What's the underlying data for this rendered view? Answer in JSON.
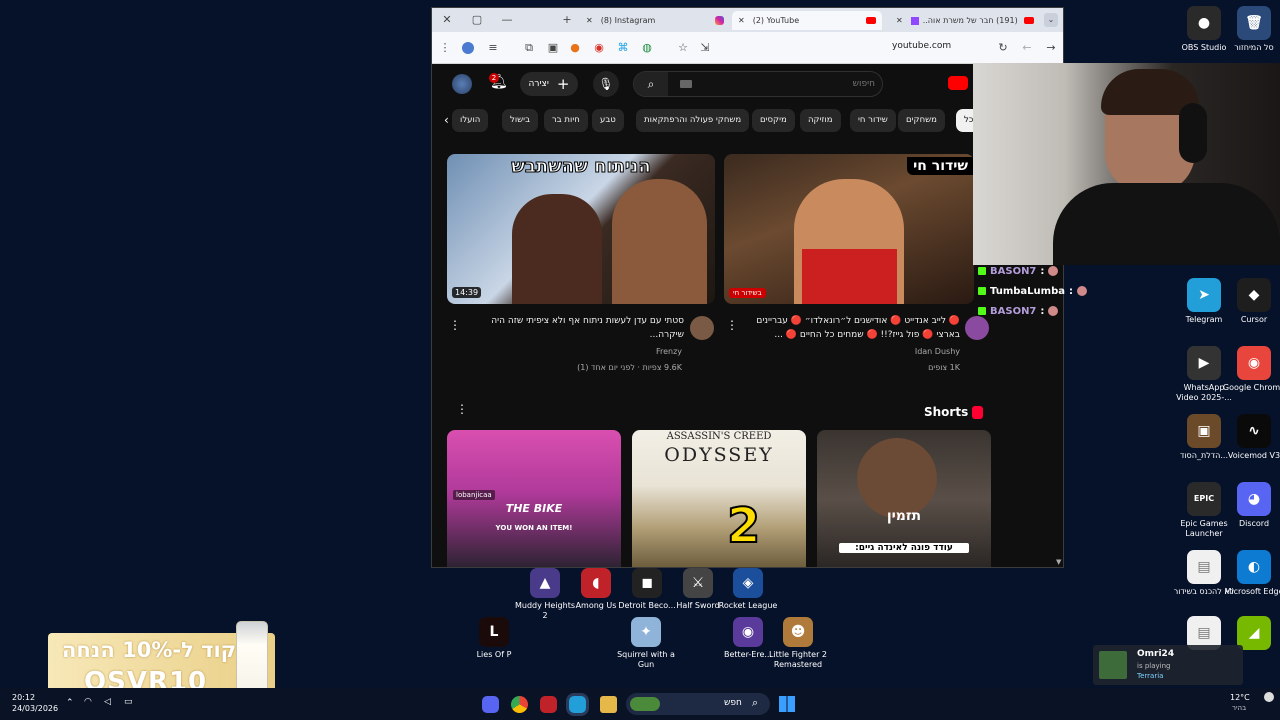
{
  "desktop": {
    "icons_right": [
      {
        "label": "OBS Studio",
        "glyph": "●",
        "color": "#2a2a2a"
      },
      {
        "label": "סל המיחזור",
        "glyph": "🗑",
        "color": "#2b4a7a"
      },
      {
        "label": "Telegram",
        "glyph": "➤",
        "color": "#229ed9"
      },
      {
        "label": "Cursor",
        "glyph": "◆",
        "color": "#1e1e1e"
      },
      {
        "label": "WhatsApp Video 2025-...",
        "glyph": "▶",
        "color": "#333"
      },
      {
        "label": "Google Chrome",
        "glyph": "◉",
        "color": "#e8453c"
      },
      {
        "label": "הדלת_הסוד...",
        "glyph": "▣",
        "color": "#6b4a2a"
      },
      {
        "label": "Voicemod V3",
        "glyph": "∿",
        "color": "#0a0a0a"
      },
      {
        "label": "Epic Games Launcher",
        "glyph": "EPIC",
        "color": "#2a2a2a"
      },
      {
        "label": "Discord",
        "glyph": "◕",
        "color": "#5865f2"
      },
      {
        "label": "לא להכנס בשידור",
        "glyph": "▤",
        "color": "#f0f0f0"
      },
      {
        "label": "Microsoft Edge",
        "glyph": "◐",
        "color": "#0c7bd1"
      },
      {
        "label": "",
        "glyph": "▤",
        "color": "#f0f0f0"
      },
      {
        "label": "",
        "glyph": "◢",
        "color": "#76b900"
      }
    ],
    "icons_bottom": [
      {
        "label": "Muddy Heights 2",
        "glyph": "▲",
        "color": "#4a3a8a"
      },
      {
        "label": "Among Us",
        "glyph": "◖",
        "color": "#c0222a"
      },
      {
        "label": "Detroit Beco...",
        "glyph": "◼",
        "color": "#222"
      },
      {
        "label": "Half Sword",
        "glyph": "⚔",
        "color": "#444"
      },
      {
        "label": "Rocket League",
        "glyph": "◈",
        "color": "#1b4f9c"
      },
      {
        "label": "Lies Of P",
        "glyph": "L",
        "color": "#1a0a0a"
      },
      {
        "label": "Squirrel with a Gun",
        "glyph": "✦",
        "color": "#8fb3d9"
      },
      {
        "label": "Better-Ere...",
        "glyph": "◉",
        "color": "#5a3a9a"
      },
      {
        "label": "Little Fighter 2 Remastered",
        "glyph": "☻",
        "color": "#b07a3a"
      }
    ],
    "promo": {
      "line1": "קוד ל-10% הנחה",
      "line2": "OSVR10"
    }
  },
  "browser": {
    "tabs": [
      {
        "label": "(8) Instagram",
        "icon": "instagram-icon"
      },
      {
        "label": "(2) YouTube",
        "icon": "youtube-icon"
      },
      {
        "label": "(191) חבר של משרת אוה...",
        "icon": "twitch-icon"
      }
    ],
    "url": "youtube.com",
    "window_controls": [
      "✕",
      "▢",
      "—"
    ]
  },
  "youtube": {
    "search_placeholder": "חיפוש",
    "create_label": "יצירה",
    "notifications_count": "2",
    "chips": [
      "הועלו",
      "בישול",
      "חיות בר",
      "טבע",
      "משחקי פעולה והרפתקאות",
      "מיקסים",
      "מוזיקה",
      "שידור חי",
      "משחקים",
      "הכל"
    ],
    "videos": [
      {
        "thumb_text": "הניתוח שהשתבש",
        "duration": "14:39",
        "title": "סטתי עם עדן לעשות ניתוח אף ולא ציפיתי שזה היה שיקרה...",
        "channel": "Frenzy",
        "stats": "9.6K צפיות · לפני יום אחד (1)"
      },
      {
        "thumb_text": "שידור חי",
        "live_badge": "בשידור חי",
        "title": "🔴 לייב אנדייט 🔴 אודישנים ל״רונאלדו״ 🔴 עבריינים בארצי 🔴 פול גייז?!! 🔴 שמחים כל החיים 🔴 ...",
        "channel": "Idan Dushy",
        "stats": "1K צופים"
      }
    ],
    "shorts_title": "Shorts",
    "shorts": [
      {
        "top": "lobanjicaa",
        "text1": "THE BIKE",
        "text2": "YOU WON AN ITEM!"
      },
      {
        "top": "ASSASSIN'S CREED",
        "text1": "ODYSSEY",
        "text2": "2"
      },
      {
        "top": "",
        "text1": "תזמין",
        "text2": "עודד פונה לאינדה גיים:"
      }
    ]
  },
  "chat": [
    {
      "user": "BASON7",
      "color": "#b39ddb"
    },
    {
      "user": "TumbaLumba",
      "color": "#ffffff"
    },
    {
      "user": "BASON7",
      "color": "#b39ddb"
    }
  ],
  "notification": {
    "user": "Omri24",
    "status": "is playing",
    "game": "Terraria"
  },
  "taskbar": {
    "search": "חפש",
    "time": "20:12",
    "date": "24/03/2026",
    "weather_temp": "12°C",
    "weather_label": "בהיר"
  }
}
